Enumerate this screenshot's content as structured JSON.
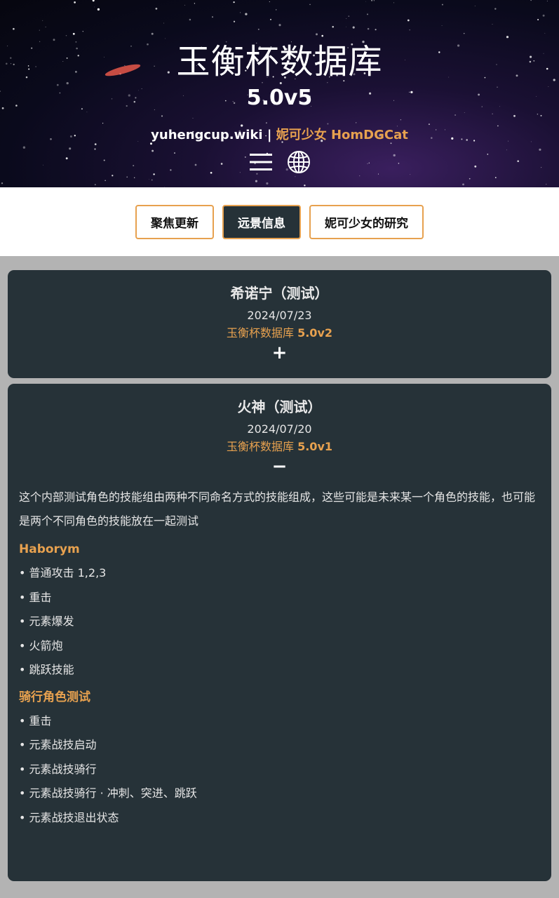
{
  "header": {
    "title": "玉衡杯数据库",
    "version": "5.0v5",
    "site": "yuhengcup.wiki",
    "separator": "|",
    "author": "妮可少女 HomDGCat",
    "icons": [
      "menu-icon",
      "globe-icon"
    ]
  },
  "tabs": [
    {
      "label": "聚焦更新",
      "active": false
    },
    {
      "label": "远景信息",
      "active": true
    },
    {
      "label": "妮可少女的研究",
      "active": false
    }
  ],
  "cards": [
    {
      "title": "希诺宁（测试）",
      "date": "2024/07/23",
      "db_label": "玉衡杯数据库",
      "db_version": "5.0v2",
      "toggle": "+"
    },
    {
      "title": "火神（测试）",
      "date": "2024/07/20",
      "db_label": "玉衡杯数据库",
      "db_version": "5.0v1",
      "toggle": "−",
      "description": "这个内部测试角色的技能组由两种不同命名方式的技能组成，这些可能是未来某一个角色的技能，也可能是两个不同角色的技能放在一起测试",
      "sections": [
        {
          "title": "Haborym",
          "items": [
            "普通攻击 1,2,3",
            "重击",
            "元素爆发",
            "火箭炮",
            "跳跃技能"
          ]
        },
        {
          "title": "骑行角色测试",
          "items": [
            "重击",
            "元素战技启动",
            "元素战技骑行",
            "元素战技骑行 · 冲刺、突进、跳跃",
            "元素战技退出状态"
          ]
        }
      ]
    }
  ],
  "colors": {
    "accent": "#e7a14f",
    "card_bg": "#263238",
    "page_bg": "#b3b3b3"
  }
}
